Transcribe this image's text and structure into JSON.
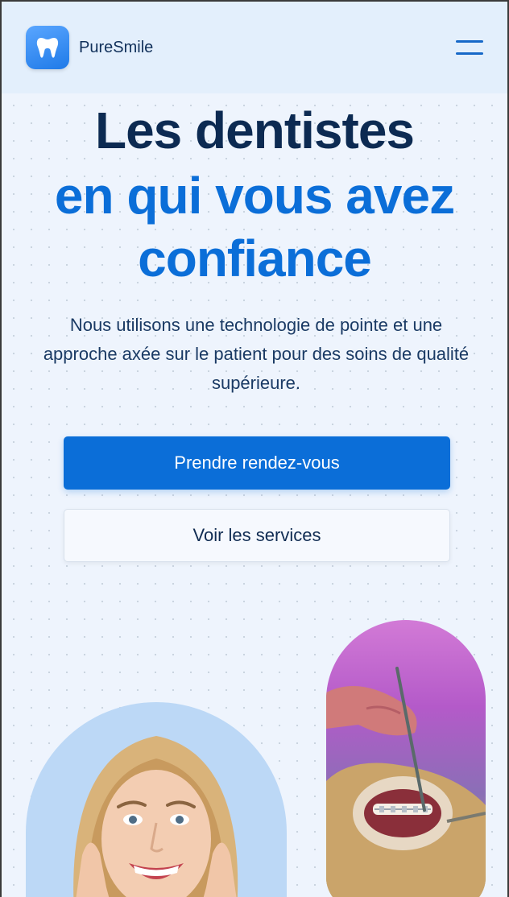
{
  "brand": {
    "name": "PureSmile",
    "logo_icon": "tooth-icon",
    "accent": "#0b6ed8"
  },
  "header": {
    "menu_icon": "hamburger-menu-icon"
  },
  "hero": {
    "title_line1": "Les dentistes",
    "title_line2": "en qui vous avez",
    "title_line3": "confiance",
    "subtitle": "Nous utilisons une technologie de pointe et une approche axée sur le patient pour des soins de qualité supérieure."
  },
  "actions": {
    "primary_label": "Prendre rendez-vous",
    "secondary_label": "Voir les services"
  },
  "images": {
    "left": "smiling-woman-photo",
    "right": "dental-braces-treatment-photo"
  }
}
